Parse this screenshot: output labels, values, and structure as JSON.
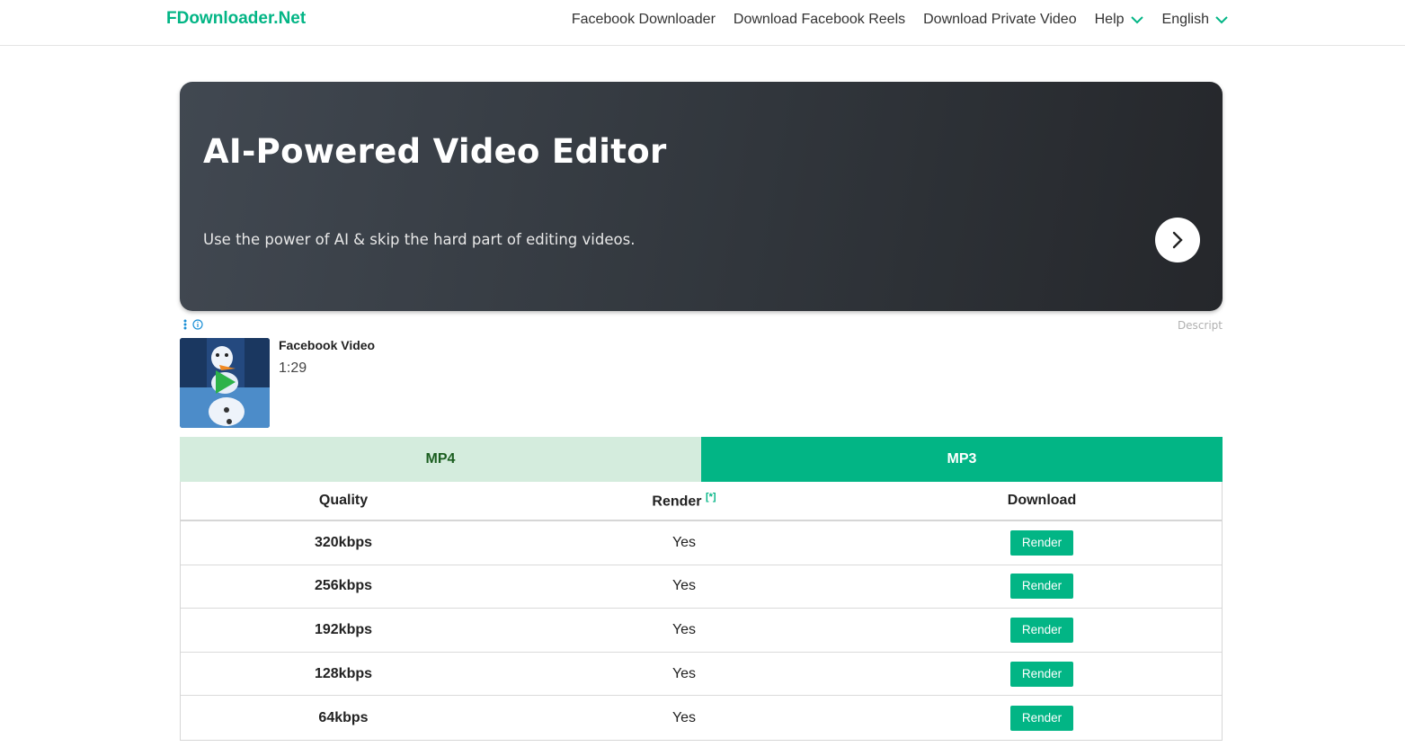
{
  "header": {
    "logo": "FDownloader.Net",
    "nav": [
      {
        "label": "Facebook Downloader"
      },
      {
        "label": "Download Facebook Reels"
      },
      {
        "label": "Download Private Video"
      },
      {
        "label": "Help"
      },
      {
        "label": "English"
      }
    ]
  },
  "ad": {
    "title": "AI-Powered Video Editor",
    "subtitle": "Use the power of AI & skip the hard part of editing videos.",
    "sponsor": "Descript"
  },
  "video": {
    "title": "Facebook Video",
    "duration": "1:29"
  },
  "tabs": [
    {
      "label": "MP4",
      "active": false
    },
    {
      "label": "MP3",
      "active": true
    }
  ],
  "table": {
    "headers": {
      "quality": "Quality",
      "render": "Render",
      "render_note": "[*]",
      "download": "Download"
    },
    "rows": [
      {
        "quality": "320kbps",
        "render": "Yes",
        "button": "Render"
      },
      {
        "quality": "256kbps",
        "render": "Yes",
        "button": "Render"
      },
      {
        "quality": "192kbps",
        "render": "Yes",
        "button": "Render"
      },
      {
        "quality": "128kbps",
        "render": "Yes",
        "button": "Render"
      },
      {
        "quality": "64kbps",
        "render": "Yes",
        "button": "Render"
      }
    ]
  },
  "colors": {
    "accent": "#02b585",
    "tab_inactive_bg": "#d4ecdd",
    "ad_bg": "#34393f"
  },
  "icons": {
    "help_dropdown": "chevron-down-icon",
    "language_dropdown": "chevron-down-icon",
    "ad_next": "chevron-right-icon",
    "ad_menu": "more-vertical-icon",
    "ad_info": "info-icon",
    "video_play": "play-icon"
  }
}
